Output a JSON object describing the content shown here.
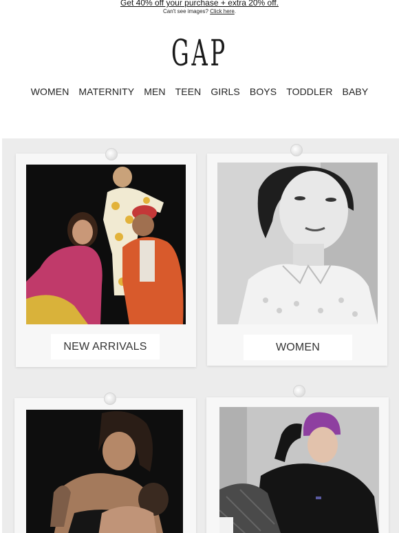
{
  "promo": {
    "link_text": "Get 40% off your purchase + extra 20% off.",
    "sub_text": "Can't see images?",
    "sub_link": "Click here",
    "sub_end": "."
  },
  "brand": {
    "logo": "GAP"
  },
  "nav": {
    "items": [
      "WOMEN",
      "MATERNITY",
      "MEN",
      "TEEN",
      "GIRLS",
      "BOYS",
      "TODDLER",
      "BABY"
    ]
  },
  "cards": [
    {
      "label": "NEW ARRIVALS",
      "image": "family-group-photo"
    },
    {
      "label": "WOMEN",
      "image": "woman-portrait-photo"
    },
    {
      "label": "",
      "image": "maternity-mother-baby-photo"
    },
    {
      "label": "",
      "image": "man-purple-beanie-photo"
    }
  ]
}
